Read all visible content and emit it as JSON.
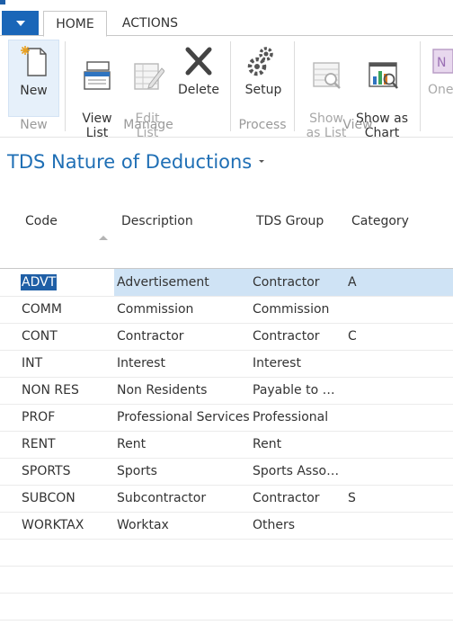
{
  "tabs": [
    "HOME",
    "ACTIONS"
  ],
  "ribbon": {
    "buttons": {
      "new": "New",
      "view_list": "View\nList",
      "edit_list": "Edit\nList",
      "delete": "Delete",
      "setup": "Setup",
      "show_as_list": "Show\nas List",
      "show_as_chart": "Show as\nChart",
      "one": "One"
    },
    "groups": {
      "new": "New",
      "manage": "Manage",
      "process": "Process",
      "view": "View"
    }
  },
  "page": {
    "title": "TDS Nature of Deductions"
  },
  "table": {
    "headers": {
      "code": "Code",
      "description": "Description",
      "tds_group": "TDS Group",
      "category": "Category"
    },
    "rows": [
      {
        "code": "ADVT",
        "description": "Advertisement",
        "tds_group": "Contractor",
        "category": "A"
      },
      {
        "code": "COMM",
        "description": "Commission",
        "tds_group": "Commission",
        "category": ""
      },
      {
        "code": "CONT",
        "description": "Contractor",
        "tds_group": "Contractor",
        "category": "C"
      },
      {
        "code": "INT",
        "description": "Interest",
        "tds_group": "Interest",
        "category": ""
      },
      {
        "code": "NON RES",
        "description": "Non Residents",
        "tds_group": "Payable to N...",
        "category": ""
      },
      {
        "code": "PROF",
        "description": "Professional Services",
        "tds_group": "Professional",
        "category": ""
      },
      {
        "code": "RENT",
        "description": "Rent",
        "tds_group": "Rent",
        "category": ""
      },
      {
        "code": "SPORTS",
        "description": "Sports",
        "tds_group": "Sports Associ...",
        "category": ""
      },
      {
        "code": "SUBCON",
        "description": "Subcontractor",
        "tds_group": "Contractor",
        "category": "S"
      },
      {
        "code": "WORKTAX",
        "description": "Worktax",
        "tds_group": "Others",
        "category": ""
      }
    ]
  },
  "colors": {
    "accent": "#1a66b8",
    "title": "#1f6fb5",
    "selected_row": "#cfe3f5",
    "selected_cell": "#1f5fa6"
  }
}
